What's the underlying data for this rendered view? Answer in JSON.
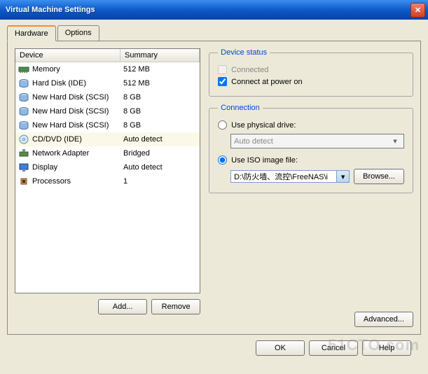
{
  "window": {
    "title": "Virtual Machine Settings"
  },
  "tabs": {
    "hardware": "Hardware",
    "options": "Options"
  },
  "table": {
    "header_device": "Device",
    "header_summary": "Summary",
    "rows": [
      {
        "icon": "memory-icon",
        "name": "Memory",
        "summary": "512 MB"
      },
      {
        "icon": "disk-icon",
        "name": "Hard Disk (IDE)",
        "summary": "512 MB"
      },
      {
        "icon": "disk-icon",
        "name": "New Hard Disk (SCSI)",
        "summary": "8 GB"
      },
      {
        "icon": "disk-icon",
        "name": "New Hard Disk (SCSI)",
        "summary": "8 GB"
      },
      {
        "icon": "disk-icon",
        "name": "New Hard Disk (SCSI)",
        "summary": "8 GB"
      },
      {
        "icon": "cd-icon",
        "name": "CD/DVD (IDE)",
        "summary": "Auto detect",
        "selected": true
      },
      {
        "icon": "network-icon",
        "name": "Network Adapter",
        "summary": "Bridged"
      },
      {
        "icon": "display-icon",
        "name": "Display",
        "summary": "Auto detect"
      },
      {
        "icon": "cpu-icon",
        "name": "Processors",
        "summary": "1"
      }
    ]
  },
  "buttons": {
    "add": "Add...",
    "remove": "Remove",
    "browse": "Browse...",
    "advanced": "Advanced...",
    "ok": "OK",
    "cancel": "Cancel",
    "help": "Help"
  },
  "device_status": {
    "legend": "Device status",
    "connected": "Connected",
    "connect_power_on": "Connect at power on",
    "connected_checked": false,
    "power_on_checked": true
  },
  "connection": {
    "legend": "Connection",
    "physical": "Use physical drive:",
    "physical_value": "Auto detect",
    "iso": "Use ISO image file:",
    "iso_path": "D:\\防火墙、流控\\FreeNAS\\i",
    "mode": "iso"
  },
  "watermark": "51CTO.com"
}
